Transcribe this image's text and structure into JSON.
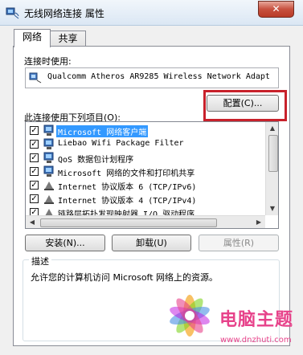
{
  "window": {
    "title": "无线网络连接 属性",
    "close_label": "✕"
  },
  "tabs": [
    {
      "label": "网络",
      "active": true
    },
    {
      "label": "共享",
      "active": false
    }
  ],
  "connect_using": {
    "label": "连接时使用:",
    "adapter": "Qualcomm Atheros AR9285 Wireless Network Adapt"
  },
  "configure_button": "配置(C)...",
  "items_label": "此连接使用下列项目(O):",
  "items": [
    {
      "label": "Microsoft 网络客户端",
      "checked": true,
      "icon": "network-client-icon",
      "selected": true
    },
    {
      "label": "Liebao Wifi Package Filter",
      "checked": true,
      "icon": "network-service-icon",
      "selected": false
    },
    {
      "label": "QoS 数据包计划程序",
      "checked": true,
      "icon": "network-service-icon",
      "selected": false
    },
    {
      "label": "Microsoft 网络的文件和打印机共享",
      "checked": true,
      "icon": "network-service-icon",
      "selected": false
    },
    {
      "label": "Internet 协议版本 6 (TCP/IPv6)",
      "checked": true,
      "icon": "protocol-icon",
      "selected": false
    },
    {
      "label": "Internet 协议版本 4 (TCP/IPv4)",
      "checked": true,
      "icon": "protocol-icon",
      "selected": false
    },
    {
      "label": "链路层拓扑发现映射器 I/O 驱动程序",
      "checked": true,
      "icon": "protocol-icon",
      "selected": false
    }
  ],
  "buttons": {
    "install": "安装(N)...",
    "uninstall": "卸载(U)",
    "properties": "属性(R)"
  },
  "description": {
    "title": "描述",
    "text": "允许您的计算机访问 Microsoft 网络上的资源。"
  },
  "watermark": {
    "main": "电脑主题",
    "url": "www.dnzhuti.com"
  },
  "colors": {
    "highlight_box": "#c8212b",
    "selection": "#3399ff",
    "watermark": "#e7428a"
  }
}
